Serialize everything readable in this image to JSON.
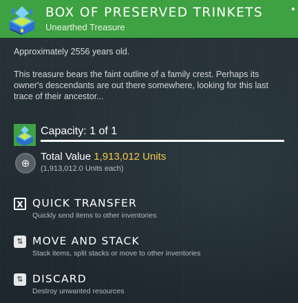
{
  "header": {
    "title": "BOX OF PRESERVED TRINKETS",
    "subtitle": "Unearthed Treasure",
    "icon": "treasure-box-icon",
    "accent": "#3ea142"
  },
  "item": {
    "age": "Approximately 2556 years old.",
    "description": "This treasure bears the faint outline of a family crest. Perhaps its owner's descendants are out there somewhere, looking for this last trace of their ancestor..."
  },
  "capacity": {
    "label": "Capacity: 1 of 1",
    "current": 1,
    "max": 1,
    "fill_fraction": 1.0
  },
  "value": {
    "label": "Total Value",
    "amount": "1,913,012 Units",
    "each": "(1,913,012.0 Units each)",
    "amount_color": "#f2c94c",
    "icon": "units-icon"
  },
  "actions": [
    {
      "key_glyph": "X",
      "icon": "x-key-icon",
      "title": "QUICK TRANSFER",
      "subtitle": "Quickly send items to other inventories"
    },
    {
      "key_glyph": "⇅",
      "icon": "move-stack-icon",
      "title": "MOVE AND STACK",
      "subtitle": "Stack items, split stacks or move to other inventories"
    },
    {
      "key_glyph": "⇅",
      "icon": "discard-icon",
      "title": "DISCARD",
      "subtitle": "Destroy unwanted resources"
    }
  ]
}
